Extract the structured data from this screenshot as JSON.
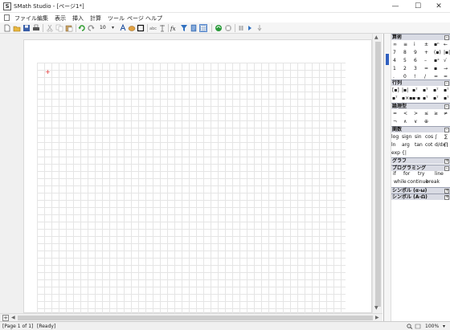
{
  "window": {
    "title": "SMath Studio - [ページ1*]",
    "icon_letter": "S",
    "minimize": "—",
    "maximize": "☐",
    "close": "✕"
  },
  "menu": {
    "items": [
      "ファイル",
      "編集",
      "表示",
      "挿入",
      "計算",
      "ツール",
      "ページ",
      "ヘルプ"
    ]
  },
  "toolbar": {
    "font_size": "10",
    "icons": [
      "new-icon",
      "open-icon",
      "save-icon",
      "print-icon",
      "cut-icon",
      "copy-icon",
      "paste-icon",
      "undo-icon",
      "redo-icon",
      "text-color-icon",
      "highlight-icon",
      "border-icon",
      "abc-icon",
      "text-region-icon",
      "function-icon",
      "filter-icon",
      "page-icon",
      "grid-icon",
      "recalculate-icon",
      "stop-icon",
      "pause-icon",
      "step-icon",
      "debug-icon"
    ]
  },
  "canvas": {
    "cursor": "+"
  },
  "status": {
    "page": "[Page 1 of 1]",
    "state": "[Ready]",
    "zoom": "100%"
  },
  "panel": {
    "sections": [
      {
        "title": "算術",
        "toggle": "–"
      },
      {
        "title": "行列",
        "toggle": "–"
      },
      {
        "title": "論理型",
        "toggle": "–"
      },
      {
        "title": "関数",
        "toggle": "–"
      },
      {
        "title": "グラフ",
        "toggle": "+"
      },
      {
        "title": "プログラミング",
        "toggle": "–"
      },
      {
        "title": "シンボル (α-ω)",
        "toggle": "+"
      },
      {
        "title": "シンボル (Α-Ω)",
        "toggle": "+"
      }
    ],
    "arith_rows": [
      [
        "∞",
        "≡",
        "i",
        "±",
        "▪ⁿ",
        "←"
      ],
      [
        "7",
        "8",
        "9",
        "+",
        "(▪)",
        "|▪|"
      ],
      [
        "4",
        "5",
        "6",
        "–",
        "▪ˣ",
        "√"
      ],
      [
        "1",
        "2",
        "3",
        "=",
        "▪",
        "→"
      ],
      [
        ".",
        "0",
        "!",
        "/",
        "=",
        "="
      ]
    ],
    "matrix_rows": [
      [
        "[▪]",
        "|▪|",
        "▪ᵀ",
        "▪ᵀ",
        "▪ᵀ",
        "▪ᵀ"
      ],
      [
        "▪ᵀ",
        "▪×▪",
        "▪·▪",
        "▪ᵀ",
        "▪ᵀ",
        "▪ᵀ"
      ]
    ],
    "logic_rows": [
      [
        "=",
        "<",
        ">",
        "≤",
        "≥",
        "≠"
      ],
      [
        "¬",
        "∧",
        "∨",
        "⊕"
      ]
    ],
    "function_rows": [
      [
        "log",
        "sign",
        "sin",
        "cos",
        "∫",
        "∑"
      ],
      [
        "ln",
        "arg",
        "tan",
        "cot",
        "d/dx",
        "∏"
      ],
      [
        "exp",
        "{|"
      ]
    ],
    "programming_rows": [
      [
        "if",
        "for",
        "try",
        "line"
      ],
      [
        "while",
        "continue",
        "break"
      ]
    ]
  }
}
